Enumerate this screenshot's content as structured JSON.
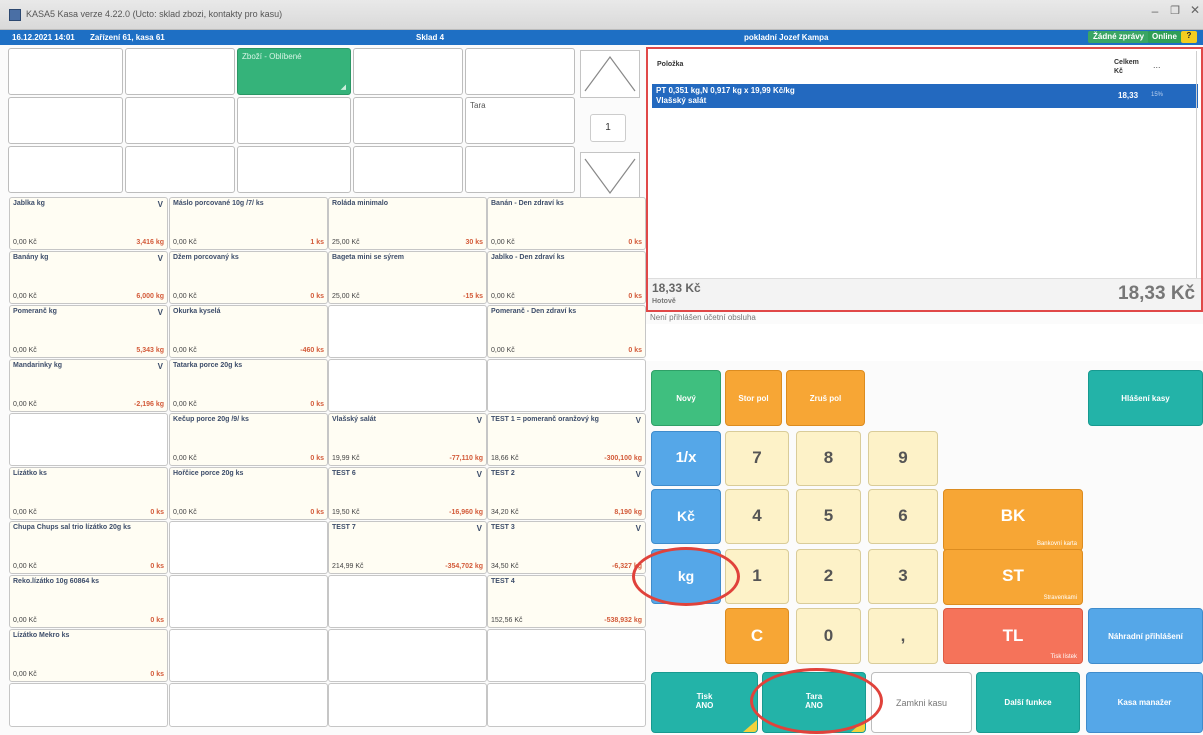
{
  "window": {
    "title": "KASA5 Kasa verze 4.22.0 (Ucto: sklad zbozi, kontakty pro kasu)"
  },
  "status_bar": {
    "datetime": "16.12.2021 14:01",
    "device": "Zařízení 61, kasa 61",
    "warehouse": "Sklad 4",
    "cashier": "pokladní Jozef Kampa",
    "messages": "Žádné zprávy",
    "online": "Online",
    "help": "?"
  },
  "quick_buttons": {
    "green_button": "Zboží - Oblíbené",
    "tara": "Tara"
  },
  "quantity": "1",
  "products": [
    {
      "name": "Jablka kg",
      "unit": "V",
      "price": "0,00 Kč",
      "stock": "3,416 kg"
    },
    {
      "name": "Máslo porcované 10g /7/ ks",
      "unit": "",
      "price": "0,00 Kč",
      "stock": "1 ks"
    },
    {
      "name": "Roláda minimalo",
      "unit": "",
      "price": "25,00 Kč",
      "stock": "30 ks"
    },
    {
      "name": "Banán - Den zdraví ks",
      "unit": "",
      "price": "0,00 Kč",
      "stock": "0 ks"
    },
    {
      "name": "Banány kg",
      "unit": "V",
      "price": "0,00 Kč",
      "stock": "6,000 kg"
    },
    {
      "name": "Džem porcovaný ks",
      "unit": "",
      "price": "0,00 Kč",
      "stock": "0 ks"
    },
    {
      "name": "Bageta mini se sýrem",
      "unit": "",
      "price": "25,00 Kč",
      "stock": "-15 ks"
    },
    {
      "name": "Jablko - Den zdraví ks",
      "unit": "",
      "price": "0,00 Kč",
      "stock": "0 ks"
    },
    {
      "name": "Pomeranč kg",
      "unit": "V",
      "price": "0,00 Kč",
      "stock": "5,343 kg"
    },
    {
      "name": "Okurka kyselá",
      "unit": "",
      "price": "0,00 Kč",
      "stock": "-460 ks"
    },
    {
      "name": "Pomeranč - Den zdraví ks",
      "unit": "",
      "price": "0,00 Kč",
      "stock": "0 ks"
    },
    {
      "name": "Mandarinky kg",
      "unit": "V",
      "price": "0,00 Kč",
      "stock": "-2,196 kg"
    },
    {
      "name": "Tatarka porce 20g ks",
      "unit": "",
      "price": "0,00 Kč",
      "stock": "0 ks"
    },
    {
      "name": "Kečup porce 20g /9/ ks",
      "unit": "",
      "price": "0,00 Kč",
      "stock": "0 ks"
    },
    {
      "name": "Vlašský salát",
      "unit": "V",
      "price": "19,99 Kč",
      "stock": "-77,110 kg"
    },
    {
      "name": "TEST 1 = pomeranč oranžový kg",
      "unit": "V",
      "price": "18,66 Kč",
      "stock": "-300,100 kg"
    },
    {
      "name": "Lízátko ks",
      "unit": "",
      "price": "0,00 Kč",
      "stock": "0 ks"
    },
    {
      "name": "Hořčice porce 20g ks",
      "unit": "",
      "price": "0,00 Kč",
      "stock": "0 ks"
    },
    {
      "name": "TEST 6",
      "unit": "V",
      "price": "19,50 Kč",
      "stock": "-16,960 kg"
    },
    {
      "name": "TEST 2",
      "unit": "V",
      "price": "34,20 Kč",
      "stock": "8,190 kg"
    },
    {
      "name": "Chupa Chups sal trio lízátko 20g ks",
      "unit": "",
      "price": "0,00 Kč",
      "stock": "0 ks"
    },
    {
      "name": "TEST 7",
      "unit": "V",
      "price": "214,99 Kč",
      "stock": "-354,702 kg"
    },
    {
      "name": "TEST 3",
      "unit": "V",
      "price": "34,50 Kč",
      "stock": "-6,327 kg"
    },
    {
      "name": "Reko.lízátko 10g 60864 ks",
      "unit": "",
      "price": "0,00 Kč",
      "stock": "0 ks"
    },
    {
      "name": "TEST 4",
      "unit": "",
      "price": "152,56 Kč",
      "stock": "-538,932 kg"
    },
    {
      "name": "Lízátko Mekro ks",
      "unit": "",
      "price": "0,00 Kč",
      "stock": "0 ks"
    }
  ],
  "receipt": {
    "col_item": "Položka",
    "col_total_line1": "Celkem",
    "col_total_line2": "Kč",
    "col_more": "...",
    "line1": "PT 0,351 kg,N 0,917 kg x 19,99 Kč/kg",
    "line2": "Vlašský salát",
    "amount": "18,33",
    "vat": "15%",
    "sum_left": "18,33 Kč",
    "cash_label": "Hotově",
    "sum_right": "18,33 Kč"
  },
  "login_message": "Není přihlášen účetní obsluha",
  "keys": {
    "new": "Nový",
    "cancel_item": "Stor pol",
    "void_item": "Zruš pol",
    "report": "Hlášení kasy",
    "inverse": "1/x",
    "czk": "Kč",
    "kg": "kg",
    "d7": "7",
    "d8": "8",
    "d9": "9",
    "d4": "4",
    "d5": "5",
    "d6": "6",
    "d1": "1",
    "d2": "2",
    "d3": "3",
    "clear": "C",
    "d0": "0",
    "comma": ",",
    "bk": "BK",
    "bk_sub": "Bankovní karta",
    "st": "ST",
    "st_sub": "Stravenkami",
    "tl": "TL",
    "tl_sub": "Tisk lístek",
    "alt_login": "Náhradní přihlášení",
    "print_1": "Tisk",
    "print_2": "ANO",
    "tara_1": "Tara",
    "tara_2": "ANO",
    "lock": "Zamkni kasu",
    "more": "Další funkce",
    "manager": "Kasa manažer"
  }
}
